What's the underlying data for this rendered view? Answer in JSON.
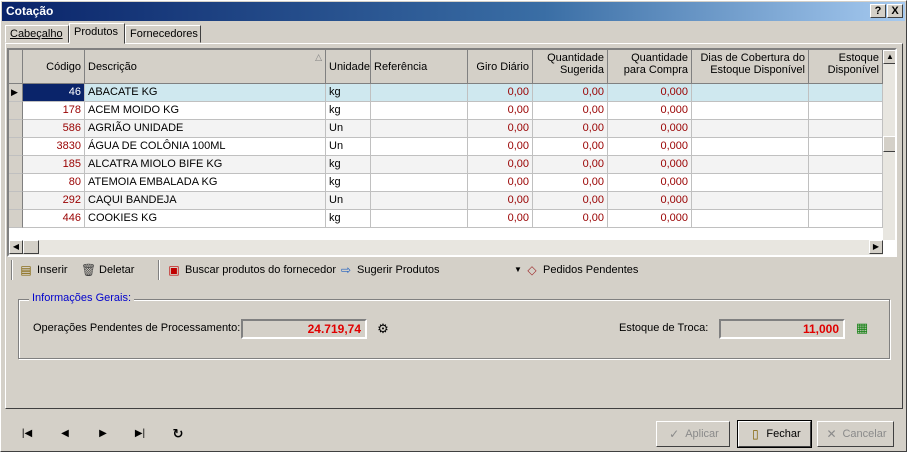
{
  "window": {
    "title": "Cotação",
    "help_label": "?",
    "close_label": "X"
  },
  "tabs": [
    {
      "label": "Cabeçalho"
    },
    {
      "label": "Produtos"
    },
    {
      "label": "Fornecedores"
    }
  ],
  "grid": {
    "columns": [
      "Código",
      "Descrição",
      "Unidade",
      "Referência",
      "Giro Diário",
      "Quantidade Sugerida",
      "Quantidade para Compra",
      "Dias de Cobertura do Estoque Disponível",
      "Estoque Disponível"
    ],
    "rows": [
      {
        "codigo": "46",
        "descricao": "ABACATE KG",
        "unidade": "kg",
        "referencia": "",
        "giro": "0,00",
        "sugerida": "0,00",
        "compra": "0,000"
      },
      {
        "codigo": "178",
        "descricao": "ACEM MOIDO  KG",
        "unidade": "kg",
        "referencia": "",
        "giro": "0,00",
        "sugerida": "0,00",
        "compra": "0,000"
      },
      {
        "codigo": "586",
        "descricao": "AGRIÃO UNIDADE",
        "unidade": "Un",
        "referencia": "",
        "giro": "0,00",
        "sugerida": "0,00",
        "compra": "0,000"
      },
      {
        "codigo": "3830",
        "descricao": "ÁGUA DE COLÔNIA 100ML",
        "unidade": "Un",
        "referencia": "",
        "giro": "0,00",
        "sugerida": "0,00",
        "compra": "0,000"
      },
      {
        "codigo": "185",
        "descricao": "ALCATRA MIOLO BIFE KG",
        "unidade": "kg",
        "referencia": "",
        "giro": "0,00",
        "sugerida": "0,00",
        "compra": "0,000"
      },
      {
        "codigo": "80",
        "descricao": "ATEMOIA EMBALADA KG",
        "unidade": "kg",
        "referencia": "",
        "giro": "0,00",
        "sugerida": "0,00",
        "compra": "0,000"
      },
      {
        "codigo": "292",
        "descricao": "CAQUI BANDEJA",
        "unidade": "Un",
        "referencia": "",
        "giro": "0,00",
        "sugerida": "0,00",
        "compra": "0,000"
      },
      {
        "codigo": "446",
        "descricao": "COOKIES KG",
        "unidade": "kg",
        "referencia": "",
        "giro": "0,00",
        "sugerida": "0,00",
        "compra": "0,000"
      }
    ]
  },
  "toolbar": {
    "inserir": "Inserir",
    "deletar": "Deletar",
    "buscar": "Buscar produtos do fornecedor",
    "sugerir": "Sugerir Produtos",
    "pedidos": "Pedidos Pendentes"
  },
  "info": {
    "title": "Informações Gerais:",
    "operacoes_label": "Operações Pendentes de Processamento:",
    "operacoes_value": "24.719,74",
    "estoque_troca_label": "Estoque de Troca:",
    "estoque_troca_value": "11,000"
  },
  "buttons": {
    "aplicar": "Aplicar",
    "fechar": "Fechar",
    "cancelar": "Cancelar"
  },
  "colors": {
    "title_start": "#0a246a",
    "title_end": "#a6caf0",
    "value_red": "#e00000",
    "code_red": "#990000",
    "selected_row": "#cfe8ef",
    "info_title": "#0000cc"
  }
}
